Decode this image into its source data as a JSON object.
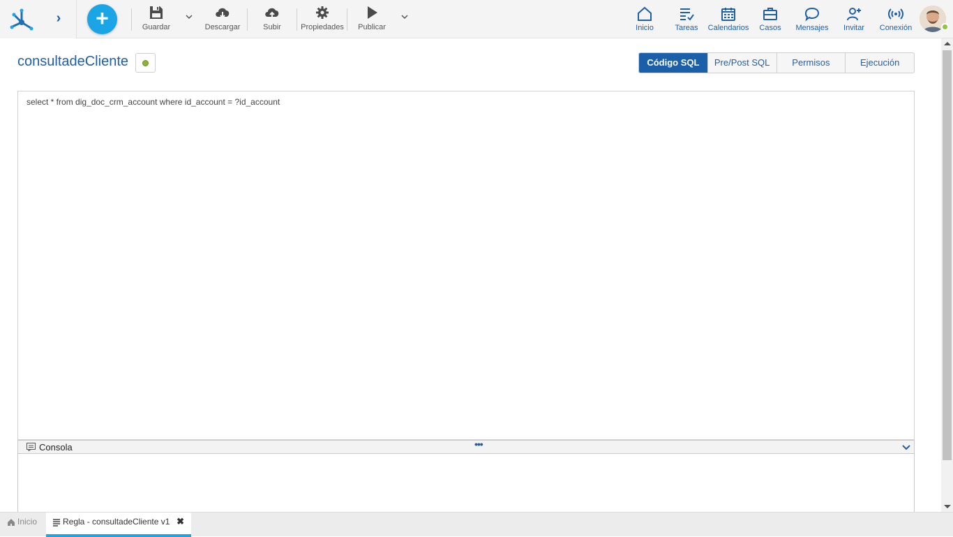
{
  "toolbar": {
    "save_label": "Guardar",
    "download_label": "Descargar",
    "upload_label": "Subir",
    "properties_label": "Propiedades",
    "publish_label": "Publicar"
  },
  "nav": {
    "home_label": "Inicio",
    "tasks_label": "Tareas",
    "calendars_label": "Calendarios",
    "cases_label": "Casos",
    "messages_label": "Mensajes",
    "invite_label": "Invitar",
    "connection_label": "Conexión"
  },
  "page": {
    "title": "consultadeCliente",
    "state_color": "#8db33a"
  },
  "tabs": [
    {
      "label": "Código SQL",
      "active": true
    },
    {
      "label": "Pre/Post SQL",
      "active": false
    },
    {
      "label": "Permisos",
      "active": false
    },
    {
      "label": "Ejecución",
      "active": false
    }
  ],
  "editor": {
    "code": "select * from dig_doc_crm_account where id_account = ?id_account"
  },
  "console": {
    "label": "Consola",
    "handle": "•••"
  },
  "bottom_tabs": {
    "home_label": "Inicio",
    "active_label": "Regla - consultadeCliente v1",
    "close_glyph": "✖"
  },
  "colors": {
    "accent": "#1aa5e6",
    "brand": "#1f5fa8",
    "active_tab": "#1a5fa8"
  }
}
